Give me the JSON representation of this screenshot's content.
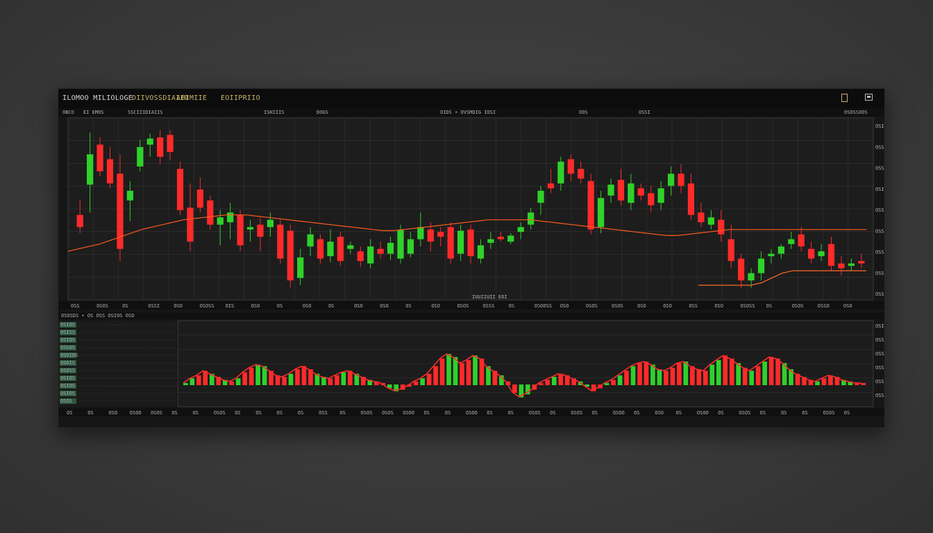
{
  "window": {
    "title": "ILOMOO MILIOLOGE",
    "menu": [
      "DIIVOSSDIAIIU",
      "AHIMIIE",
      "EOIIPRIIO"
    ],
    "subheader": [
      "OBCO",
      "EI EMOS",
      "SSCIIIDIAIIS",
      "ISHIIIS",
      "DOGS",
      "OIDS • OVSMDIG IOSI",
      "OOS",
      "OSSI",
      "OSOSSOOS"
    ]
  },
  "colors": {
    "background": "#3a3a3a",
    "panel": "#161616",
    "up": "#2fd12a",
    "down": "#ff2a2a",
    "moving_average": "#ff5a1f",
    "grid": "#3a3a3a",
    "label_accent": "#c8b46a"
  },
  "main_chart": {
    "y_labels": [
      "OSI",
      "OSS",
      "OSS",
      "OSI",
      "OSS",
      "OSS",
      "OSS",
      "OSS",
      "OSS"
    ],
    "x_labels": [
      "OSS",
      "OSOS",
      "OS",
      "OSSI",
      "OSO",
      "OSOSS",
      "OIS",
      "OSO",
      "OS",
      "OSO",
      "OS",
      "OSO",
      "OSO",
      "OS",
      "OSO",
      "OSOS",
      "OSSS",
      "OS",
      "OSOOSS",
      "OSO",
      "OSOS",
      "OSOS",
      "OSO",
      "OSO",
      "OSS",
      "OSO",
      "OSOSS",
      "OS",
      "OSOS",
      "OSSO",
      "OSO"
    ],
    "watermark": "IUUIIUII EOI",
    "candles": [
      {
        "o": 70,
        "h": 82,
        "l": 55,
        "c": 60
      },
      {
        "o": 95,
        "h": 138,
        "l": 72,
        "c": 120
      },
      {
        "o": 128,
        "h": 134,
        "l": 102,
        "c": 106
      },
      {
        "o": 116,
        "h": 126,
        "l": 92,
        "c": 96
      },
      {
        "o": 104,
        "h": 120,
        "l": 32,
        "c": 42
      },
      {
        "o": 82,
        "h": 98,
        "l": 65,
        "c": 90
      },
      {
        "o": 110,
        "h": 132,
        "l": 106,
        "c": 126
      },
      {
        "o": 128,
        "h": 137,
        "l": 118,
        "c": 133
      },
      {
        "o": 134,
        "h": 140,
        "l": 112,
        "c": 118
      },
      {
        "o": 136,
        "h": 140,
        "l": 115,
        "c": 122
      },
      {
        "o": 108,
        "h": 114,
        "l": 70,
        "c": 74
      },
      {
        "o": 76,
        "h": 96,
        "l": 40,
        "c": 48
      },
      {
        "o": 91,
        "h": 101,
        "l": 72,
        "c": 76
      },
      {
        "o": 82,
        "h": 86,
        "l": 58,
        "c": 62
      },
      {
        "o": 62,
        "h": 74,
        "l": 45,
        "c": 68
      },
      {
        "o": 64,
        "h": 80,
        "l": 50,
        "c": 72
      },
      {
        "o": 70,
        "h": 74,
        "l": 40,
        "c": 45
      },
      {
        "o": 58,
        "h": 66,
        "l": 48,
        "c": 60
      },
      {
        "o": 62,
        "h": 68,
        "l": 40,
        "c": 52
      },
      {
        "o": 60,
        "h": 72,
        "l": 52,
        "c": 66
      },
      {
        "o": 62,
        "h": 66,
        "l": 30,
        "c": 34
      },
      {
        "o": 57,
        "h": 62,
        "l": 10,
        "c": 16
      },
      {
        "o": 18,
        "h": 42,
        "l": 12,
        "c": 35
      },
      {
        "o": 44,
        "h": 60,
        "l": 36,
        "c": 54
      },
      {
        "o": 50,
        "h": 54,
        "l": 30,
        "c": 34
      },
      {
        "o": 36,
        "h": 58,
        "l": 31,
        "c": 48
      },
      {
        "o": 52,
        "h": 56,
        "l": 28,
        "c": 32
      },
      {
        "o": 42,
        "h": 48,
        "l": 38,
        "c": 45
      },
      {
        "o": 40,
        "h": 44,
        "l": 27,
        "c": 32
      },
      {
        "o": 30,
        "h": 50,
        "l": 26,
        "c": 44
      },
      {
        "o": 42,
        "h": 48,
        "l": 34,
        "c": 38
      },
      {
        "o": 38,
        "h": 52,
        "l": 33,
        "c": 47
      },
      {
        "o": 34,
        "h": 62,
        "l": 30,
        "c": 58
      },
      {
        "o": 38,
        "h": 56,
        "l": 35,
        "c": 50
      },
      {
        "o": 50,
        "h": 72,
        "l": 44,
        "c": 60
      },
      {
        "o": 58,
        "h": 64,
        "l": 40,
        "c": 48
      },
      {
        "o": 56,
        "h": 60,
        "l": 44,
        "c": 52
      },
      {
        "o": 60,
        "h": 64,
        "l": 30,
        "c": 34
      },
      {
        "o": 38,
        "h": 62,
        "l": 32,
        "c": 57
      },
      {
        "o": 58,
        "h": 62,
        "l": 30,
        "c": 36
      },
      {
        "o": 34,
        "h": 50,
        "l": 30,
        "c": 45
      },
      {
        "o": 47,
        "h": 56,
        "l": 42,
        "c": 50
      },
      {
        "o": 52,
        "h": 56,
        "l": 48,
        "c": 50
      },
      {
        "o": 48,
        "h": 55,
        "l": 46,
        "c": 53
      },
      {
        "o": 56,
        "h": 64,
        "l": 50,
        "c": 60
      },
      {
        "o": 62,
        "h": 76,
        "l": 58,
        "c": 72
      },
      {
        "o": 80,
        "h": 94,
        "l": 70,
        "c": 90
      },
      {
        "o": 96,
        "h": 108,
        "l": 88,
        "c": 92
      },
      {
        "o": 96,
        "h": 118,
        "l": 90,
        "c": 114
      },
      {
        "o": 116,
        "h": 120,
        "l": 98,
        "c": 104
      },
      {
        "o": 108,
        "h": 114,
        "l": 96,
        "c": 100
      },
      {
        "o": 98,
        "h": 104,
        "l": 54,
        "c": 58
      },
      {
        "o": 60,
        "h": 90,
        "l": 55,
        "c": 84
      },
      {
        "o": 86,
        "h": 100,
        "l": 80,
        "c": 95
      },
      {
        "o": 99,
        "h": 108,
        "l": 78,
        "c": 82
      },
      {
        "o": 80,
        "h": 104,
        "l": 74,
        "c": 96
      },
      {
        "o": 92,
        "h": 96,
        "l": 82,
        "c": 86
      },
      {
        "o": 88,
        "h": 94,
        "l": 72,
        "c": 78
      },
      {
        "o": 80,
        "h": 98,
        "l": 74,
        "c": 92
      },
      {
        "o": 94,
        "h": 110,
        "l": 86,
        "c": 104
      },
      {
        "o": 104,
        "h": 112,
        "l": 88,
        "c": 94
      },
      {
        "o": 96,
        "h": 104,
        "l": 66,
        "c": 70
      },
      {
        "o": 72,
        "h": 80,
        "l": 60,
        "c": 64
      },
      {
        "o": 62,
        "h": 74,
        "l": 58,
        "c": 68
      },
      {
        "o": 66,
        "h": 74,
        "l": 48,
        "c": 54
      },
      {
        "o": 50,
        "h": 62,
        "l": 26,
        "c": 32
      },
      {
        "o": 34,
        "h": 38,
        "l": 10,
        "c": 16
      },
      {
        "o": 16,
        "h": 26,
        "l": 10,
        "c": 22
      },
      {
        "o": 22,
        "h": 40,
        "l": 16,
        "c": 34
      },
      {
        "o": 36,
        "h": 42,
        "l": 30,
        "c": 38
      },
      {
        "o": 38,
        "h": 46,
        "l": 34,
        "c": 44
      },
      {
        "o": 46,
        "h": 56,
        "l": 42,
        "c": 50
      },
      {
        "o": 54,
        "h": 60,
        "l": 40,
        "c": 44
      },
      {
        "o": 42,
        "h": 48,
        "l": 30,
        "c": 34
      },
      {
        "o": 36,
        "h": 46,
        "l": 32,
        "c": 40
      },
      {
        "o": 46,
        "h": 52,
        "l": 24,
        "c": 28
      },
      {
        "o": 30,
        "h": 36,
        "l": 20,
        "c": 26
      },
      {
        "o": 28,
        "h": 34,
        "l": 24,
        "c": 30
      },
      {
        "o": 32,
        "h": 38,
        "l": 26,
        "c": 30
      }
    ],
    "moving_average": [
      40,
      42,
      44,
      46,
      49,
      52,
      55,
      58,
      60,
      62,
      64,
      66,
      67,
      68,
      69,
      70,
      70,
      70,
      69,
      68,
      67,
      66,
      65,
      64,
      63,
      62,
      61,
      60,
      59,
      58,
      57,
      57,
      58,
      59,
      60,
      61,
      62,
      63,
      64,
      65,
      66,
      66,
      66,
      66,
      66,
      65,
      64,
      63,
      62,
      61,
      60,
      59,
      58,
      57,
      56,
      55,
      54,
      53,
      53,
      54,
      55,
      56,
      57,
      58,
      58,
      58,
      58,
      58,
      58,
      58,
      58,
      58,
      58,
      58,
      58,
      58,
      58
    ],
    "second_line": [
      null,
      null,
      null,
      null,
      null,
      null,
      null,
      null,
      null,
      null,
      null,
      null,
      null,
      null,
      null,
      null,
      null,
      null,
      null,
      null,
      null,
      null,
      null,
      null,
      null,
      null,
      null,
      null,
      null,
      null,
      null,
      null,
      null,
      null,
      null,
      null,
      null,
      null,
      null,
      null,
      null,
      null,
      null,
      null,
      null,
      null,
      null,
      null,
      null,
      null,
      null,
      null,
      null,
      null,
      null,
      null,
      null,
      null,
      null,
      null,
      12,
      12,
      12,
      12,
      12,
      12,
      14,
      18,
      22,
      24,
      24,
      24,
      24,
      24,
      24,
      24,
      24
    ]
  },
  "indicator": {
    "title": "OSOSDS • OS OSS OSIOS OSO",
    "legend": [
      "OSIOS",
      "OSISS",
      "OSIOS",
      "OSSOS",
      "OSOIOS",
      "OSOIS",
      "OSOSS",
      "OSIOS",
      "OSIOS",
      "OSIOS",
      "OSOS"
    ],
    "y_labels": [
      "OSI",
      "OSS",
      "OSS",
      "OSS",
      "OSS",
      "OSS"
    ],
    "x_labels": [
      "OS",
      "OS",
      "OSO",
      "OSOO",
      "OSOS",
      "OS",
      "OS",
      "OSOS",
      "OS",
      "OS",
      "OS",
      "OS",
      "OSS",
      "OS",
      "OSOS",
      "OSOS",
      "OSOO",
      "OS",
      "OS",
      "OSOO",
      "OS",
      "OS",
      "OSOS",
      "OS",
      "OSOS",
      "OS",
      "OSOO",
      "OS",
      "OSO",
      "OS",
      "OSOO",
      "OS",
      "OSOS",
      "OS",
      "OS",
      "OS",
      "OSOS",
      "OS"
    ],
    "values": [
      2,
      8,
      12,
      18,
      14,
      10,
      6,
      4,
      8,
      16,
      22,
      26,
      24,
      18,
      12,
      10,
      14,
      20,
      24,
      20,
      14,
      10,
      8,
      12,
      16,
      18,
      14,
      10,
      6,
      4,
      2,
      -4,
      -8,
      -6,
      -2,
      4,
      8,
      14,
      24,
      34,
      40,
      36,
      28,
      32,
      38,
      34,
      24,
      18,
      12,
      4,
      -10,
      -16,
      -12,
      -6,
      2,
      6,
      10,
      14,
      12,
      8,
      4,
      -2,
      -8,
      -4,
      2,
      6,
      12,
      18,
      24,
      28,
      30,
      26,
      20,
      18,
      22,
      28,
      30,
      24,
      20,
      18,
      26,
      32,
      38,
      34,
      28,
      22,
      18,
      24,
      30,
      36,
      34,
      28,
      20,
      14,
      10,
      6,
      4,
      8,
      12,
      10,
      6,
      4,
      2,
      2
    ]
  }
}
